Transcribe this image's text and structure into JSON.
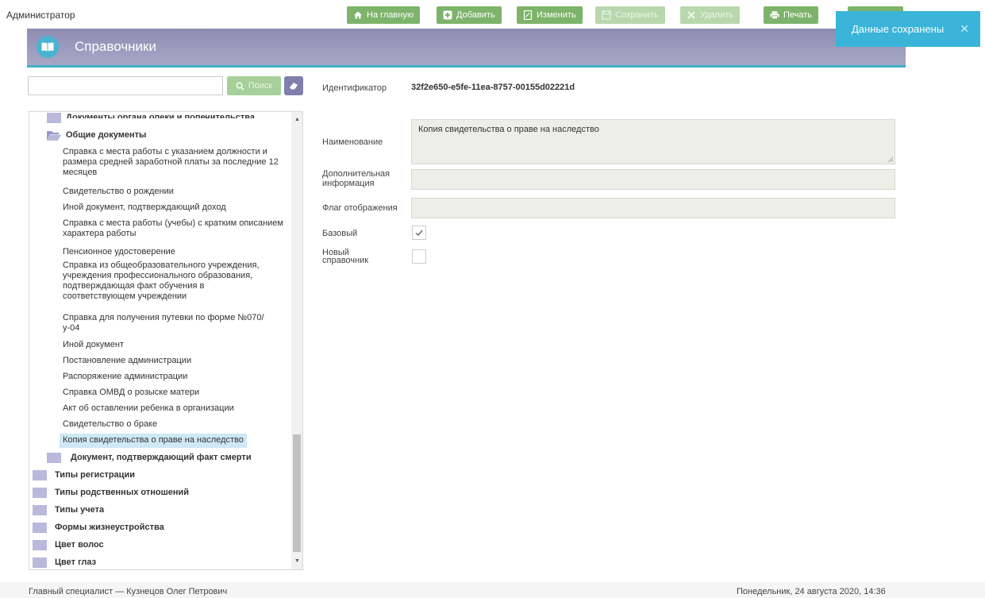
{
  "topbar": {
    "user": "Администратор",
    "buttons": {
      "home": "На главную",
      "add": "Добавить",
      "edit": "Изменить",
      "save": "Сохранить",
      "delete": "Удалить",
      "print": "Печать"
    }
  },
  "header": {
    "title": "Справочники"
  },
  "toast": {
    "message": "Данные сохранены",
    "close": "✕"
  },
  "search": {
    "value": "",
    "button_label": "Поиск"
  },
  "tree": {
    "cut_top_item": "Документы органа опеки и попечительства",
    "open_folder": "Общие документы",
    "leaves": [
      "Справка с места работы с указанием должности и размера средней заработной платы за последние 12 месяцев",
      "Свидетельство о рождении",
      "Иной документ, подтверждающий доход",
      "Справка с места работы (учебы) с кратким описанием характера работы",
      "Пенсионное удостоверение",
      "Справка из общеобразовательного учреждения, учреждения профессионального образования, подтверждающая факт обучения в соответствующем учреждении",
      "Справка для получения путевки по форме №070/у-04",
      "Иной документ",
      "Постановление администрации",
      "Распоряжение администрации",
      "Справка ОМВД о розыске матери",
      "Акт об оставлении ребенка в организации",
      "Свидетельство о браке",
      "Копия свидетельства о праве на наследство"
    ],
    "subfolder": "Документ, подтверждающий факт смерти",
    "root_folders": [
      "Типы регистрации",
      "Типы родственных отношений",
      "Типы учета",
      "Формы жизнеустройства",
      "Цвет волос",
      "Цвет глаз"
    ]
  },
  "form": {
    "identifier_label": "Идентификатор",
    "identifier_value": "32f2e650-e5fe-11ea-8757-00155d02221d",
    "name_label": "Наименование",
    "name_value": "Копия свидетельства о праве на наследство",
    "extra_label_1": "Дополнительная",
    "extra_label_2": "информация",
    "extra_value": "",
    "flag_label": "Флаг отображения",
    "flag_value": "",
    "base_label": "Базовый",
    "base_checked": true,
    "new_label_1": "Новый",
    "new_label_2": "справочник",
    "new_checked": false
  },
  "footer": {
    "user": "Главный специалист — Кузнецов Олег Петрович",
    "datetime": "Понедельник, 24 августа 2020, 14:36"
  },
  "colors": {
    "green": "#7db36a",
    "header": "#9999bb",
    "accent": "#3ab4d8",
    "folder": "#b9b9dc"
  }
}
